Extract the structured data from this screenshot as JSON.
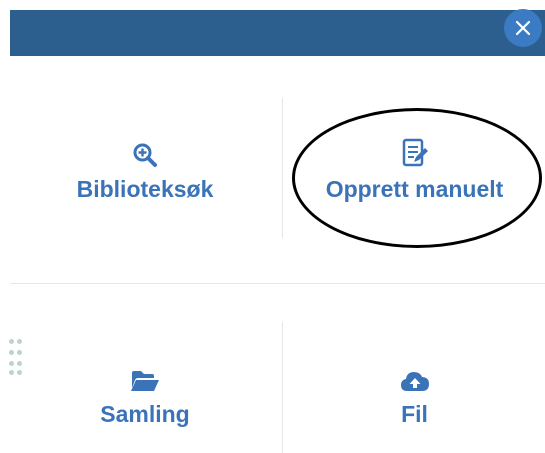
{
  "header": {
    "close_icon": "close-icon",
    "colors": {
      "bar": "#2c5f8e",
      "close_button": "#3a7bc4"
    }
  },
  "options": {
    "library_search": {
      "label": "Biblioteksøk",
      "icon": "zoom-in-icon"
    },
    "create_manually": {
      "label": "Opprett manuelt",
      "icon": "edit-document-icon"
    },
    "collection": {
      "label": "Samling",
      "icon": "folder-open-icon"
    },
    "file": {
      "label": "Fil",
      "icon": "cloud-upload-icon"
    }
  },
  "accent_color": "#3b73b8"
}
